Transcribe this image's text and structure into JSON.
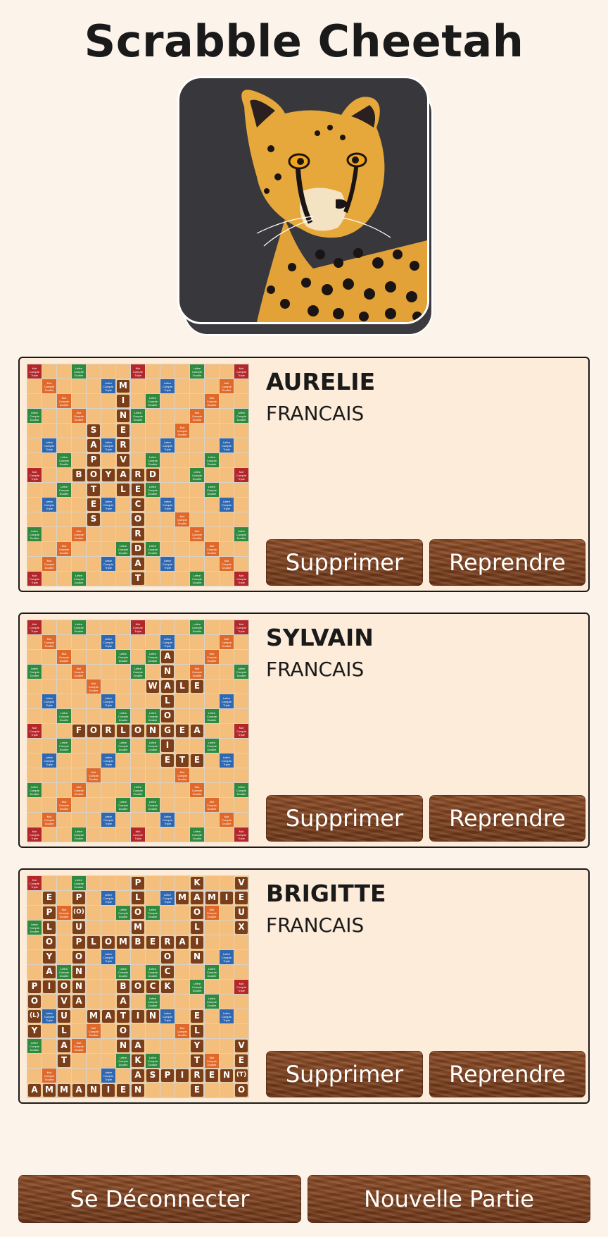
{
  "app": {
    "title": "Scrabble Cheetah",
    "logo_icon": "cheetah-icon"
  },
  "games": [
    {
      "player": "AURELIE",
      "language": "FRANCAIS",
      "delete_label": "Supprimer",
      "resume_label": "Reprendre",
      "tiles": [
        {
          "r": 1,
          "c": 6,
          "l": "M"
        },
        {
          "r": 2,
          "c": 6,
          "l": "I"
        },
        {
          "r": 3,
          "c": 6,
          "l": "N"
        },
        {
          "r": 4,
          "c": 6,
          "l": "E"
        },
        {
          "r": 5,
          "c": 6,
          "l": "R"
        },
        {
          "r": 6,
          "c": 6,
          "l": "V"
        },
        {
          "r": 4,
          "c": 4,
          "l": "S"
        },
        {
          "r": 5,
          "c": 4,
          "l": "A"
        },
        {
          "r": 6,
          "c": 4,
          "l": "P"
        },
        {
          "r": 7,
          "c": 3,
          "l": "B"
        },
        {
          "r": 7,
          "c": 4,
          "l": "O"
        },
        {
          "r": 7,
          "c": 5,
          "l": "Y"
        },
        {
          "r": 7,
          "c": 6,
          "l": "A"
        },
        {
          "r": 7,
          "c": 7,
          "l": "R"
        },
        {
          "r": 7,
          "c": 8,
          "l": "D"
        },
        {
          "r": 8,
          "c": 4,
          "l": "T"
        },
        {
          "r": 8,
          "c": 6,
          "l": "L"
        },
        {
          "r": 8,
          "c": 7,
          "l": "E"
        },
        {
          "r": 9,
          "c": 4,
          "l": "E"
        },
        {
          "r": 10,
          "c": 4,
          "l": "S"
        },
        {
          "r": 9,
          "c": 7,
          "l": "C"
        },
        {
          "r": 10,
          "c": 7,
          "l": "O"
        },
        {
          "r": 11,
          "c": 7,
          "l": "R"
        },
        {
          "r": 12,
          "c": 7,
          "l": "D"
        },
        {
          "r": 13,
          "c": 7,
          "l": "A"
        },
        {
          "r": 14,
          "c": 7,
          "l": "T"
        }
      ]
    },
    {
      "player": "SYLVAIN",
      "language": "FRANCAIS",
      "delete_label": "Supprimer",
      "resume_label": "Reprendre",
      "tiles": [
        {
          "r": 2,
          "c": 9,
          "l": "A"
        },
        {
          "r": 3,
          "c": 9,
          "l": "N"
        },
        {
          "r": 4,
          "c": 8,
          "l": "W"
        },
        {
          "r": 4,
          "c": 9,
          "l": "A"
        },
        {
          "r": 4,
          "c": 10,
          "l": "L"
        },
        {
          "r": 4,
          "c": 11,
          "l": "E"
        },
        {
          "r": 5,
          "c": 9,
          "l": "L"
        },
        {
          "r": 6,
          "c": 9,
          "l": "O"
        },
        {
          "r": 7,
          "c": 3,
          "l": "F"
        },
        {
          "r": 7,
          "c": 4,
          "l": "O"
        },
        {
          "r": 7,
          "c": 5,
          "l": "R"
        },
        {
          "r": 7,
          "c": 6,
          "l": "L"
        },
        {
          "r": 7,
          "c": 7,
          "l": "O"
        },
        {
          "r": 7,
          "c": 8,
          "l": "N"
        },
        {
          "r": 7,
          "c": 9,
          "l": "G"
        },
        {
          "r": 7,
          "c": 10,
          "l": "E"
        },
        {
          "r": 7,
          "c": 11,
          "l": "A"
        },
        {
          "r": 8,
          "c": 9,
          "l": "I"
        },
        {
          "r": 9,
          "c": 9,
          "l": "E"
        },
        {
          "r": 9,
          "c": 10,
          "l": "T"
        },
        {
          "r": 9,
          "c": 11,
          "l": "E"
        }
      ]
    },
    {
      "player": "BRIGITTE",
      "language": "FRANCAIS",
      "delete_label": "Supprimer",
      "resume_label": "Reprendre",
      "tiles": [
        {
          "r": 0,
          "c": 7,
          "l": "P"
        },
        {
          "r": 0,
          "c": 11,
          "l": "K"
        },
        {
          "r": 0,
          "c": 14,
          "l": "V"
        },
        {
          "r": 1,
          "c": 1,
          "l": "E"
        },
        {
          "r": 1,
          "c": 3,
          "l": "P"
        },
        {
          "r": 1,
          "c": 7,
          "l": "L"
        },
        {
          "r": 1,
          "c": 10,
          "l": "M"
        },
        {
          "r": 1,
          "c": 11,
          "l": "A"
        },
        {
          "r": 1,
          "c": 12,
          "l": "M"
        },
        {
          "r": 1,
          "c": 13,
          "l": "I"
        },
        {
          "r": 1,
          "c": 14,
          "l": "E"
        },
        {
          "r": 2,
          "c": 1,
          "l": "P"
        },
        {
          "r": 2,
          "c": 3,
          "l": "(O)"
        },
        {
          "r": 2,
          "c": 7,
          "l": "O"
        },
        {
          "r": 2,
          "c": 11,
          "l": "O"
        },
        {
          "r": 2,
          "c": 14,
          "l": "U"
        },
        {
          "r": 3,
          "c": 1,
          "l": "L"
        },
        {
          "r": 3,
          "c": 3,
          "l": "U"
        },
        {
          "r": 3,
          "c": 7,
          "l": "M"
        },
        {
          "r": 3,
          "c": 11,
          "l": "L"
        },
        {
          "r": 3,
          "c": 14,
          "l": "X"
        },
        {
          "r": 4,
          "c": 1,
          "l": "O"
        },
        {
          "r": 4,
          "c": 3,
          "l": "P"
        },
        {
          "r": 4,
          "c": 4,
          "l": "L"
        },
        {
          "r": 4,
          "c": 5,
          "l": "O"
        },
        {
          "r": 4,
          "c": 6,
          "l": "M"
        },
        {
          "r": 4,
          "c": 7,
          "l": "B"
        },
        {
          "r": 4,
          "c": 8,
          "l": "E"
        },
        {
          "r": 4,
          "c": 9,
          "l": "R"
        },
        {
          "r": 4,
          "c": 10,
          "l": "A"
        },
        {
          "r": 4,
          "c": 11,
          "l": "I"
        },
        {
          "r": 5,
          "c": 1,
          "l": "Y"
        },
        {
          "r": 5,
          "c": 3,
          "l": "O"
        },
        {
          "r": 5,
          "c": 9,
          "l": "O"
        },
        {
          "r": 5,
          "c": 11,
          "l": "N"
        },
        {
          "r": 6,
          "c": 1,
          "l": "A"
        },
        {
          "r": 6,
          "c": 3,
          "l": "N"
        },
        {
          "r": 6,
          "c": 9,
          "l": "C"
        },
        {
          "r": 7,
          "c": 0,
          "l": "P"
        },
        {
          "r": 7,
          "c": 1,
          "l": "I"
        },
        {
          "r": 7,
          "c": 2,
          "l": "O"
        },
        {
          "r": 7,
          "c": 3,
          "l": "N"
        },
        {
          "r": 7,
          "c": 6,
          "l": "B"
        },
        {
          "r": 7,
          "c": 7,
          "l": "O"
        },
        {
          "r": 7,
          "c": 8,
          "l": "C"
        },
        {
          "r": 7,
          "c": 9,
          "l": "K"
        },
        {
          "r": 8,
          "c": 0,
          "l": "O"
        },
        {
          "r": 8,
          "c": 2,
          "l": "V"
        },
        {
          "r": 8,
          "c": 3,
          "l": "A"
        },
        {
          "r": 8,
          "c": 6,
          "l": "A"
        },
        {
          "r": 9,
          "c": 0,
          "l": "(L)"
        },
        {
          "r": 9,
          "c": 2,
          "l": "U"
        },
        {
          "r": 9,
          "c": 4,
          "l": "M"
        },
        {
          "r": 9,
          "c": 5,
          "l": "A"
        },
        {
          "r": 9,
          "c": 6,
          "l": "T"
        },
        {
          "r": 9,
          "c": 7,
          "l": "I"
        },
        {
          "r": 9,
          "c": 8,
          "l": "N"
        },
        {
          "r": 9,
          "c": 11,
          "l": "E"
        },
        {
          "r": 10,
          "c": 0,
          "l": "Y"
        },
        {
          "r": 10,
          "c": 2,
          "l": "L"
        },
        {
          "r": 10,
          "c": 6,
          "l": "O"
        },
        {
          "r": 10,
          "c": 11,
          "l": "L"
        },
        {
          "r": 11,
          "c": 2,
          "l": "A"
        },
        {
          "r": 11,
          "c": 6,
          "l": "N"
        },
        {
          "r": 11,
          "c": 7,
          "l": "A"
        },
        {
          "r": 11,
          "c": 11,
          "l": "Y"
        },
        {
          "r": 11,
          "c": 14,
          "l": "V"
        },
        {
          "r": 12,
          "c": 2,
          "l": "T"
        },
        {
          "r": 12,
          "c": 7,
          "l": "K"
        },
        {
          "r": 12,
          "c": 11,
          "l": "T"
        },
        {
          "r": 12,
          "c": 14,
          "l": "E"
        },
        {
          "r": 13,
          "c": 7,
          "l": "A"
        },
        {
          "r": 13,
          "c": 8,
          "l": "S"
        },
        {
          "r": 13,
          "c": 9,
          "l": "P"
        },
        {
          "r": 13,
          "c": 10,
          "l": "I"
        },
        {
          "r": 13,
          "c": 11,
          "l": "R"
        },
        {
          "r": 13,
          "c": 12,
          "l": "E"
        },
        {
          "r": 13,
          "c": 13,
          "l": "N"
        },
        {
          "r": 13,
          "c": 14,
          "l": "(T)"
        },
        {
          "r": 14,
          "c": 0,
          "l": "A"
        },
        {
          "r": 14,
          "c": 1,
          "l": "M"
        },
        {
          "r": 14,
          "c": 2,
          "l": "M"
        },
        {
          "r": 14,
          "c": 3,
          "l": "A"
        },
        {
          "r": 14,
          "c": 4,
          "l": "N"
        },
        {
          "r": 14,
          "c": 5,
          "l": "I"
        },
        {
          "r": 14,
          "c": 6,
          "l": "E"
        },
        {
          "r": 14,
          "c": 7,
          "l": "N"
        },
        {
          "r": 14,
          "c": 11,
          "l": "E"
        },
        {
          "r": 14,
          "c": 14,
          "l": "O"
        }
      ]
    }
  ],
  "premium_labels": {
    "TW": [
      "Mot",
      "Compte",
      "Triple"
    ],
    "DW": [
      "Mot",
      "Compte",
      "Double"
    ],
    "TL": [
      "Lettre",
      "Compte",
      "Triple"
    ],
    "DL": [
      "Lettre",
      "Compte",
      "Double"
    ]
  },
  "colors": {
    "TW": "#b3262a",
    "DW": "#e0692a",
    "TL": "#2f68b0",
    "DL": "#2f8a3f",
    "square": "#f4bf7c",
    "tile": "#7a3f1a",
    "grid": "#e8e0d2"
  },
  "footer": {
    "logout_label": "Se Déconnecter",
    "new_game_label": "Nouvelle Partie"
  }
}
